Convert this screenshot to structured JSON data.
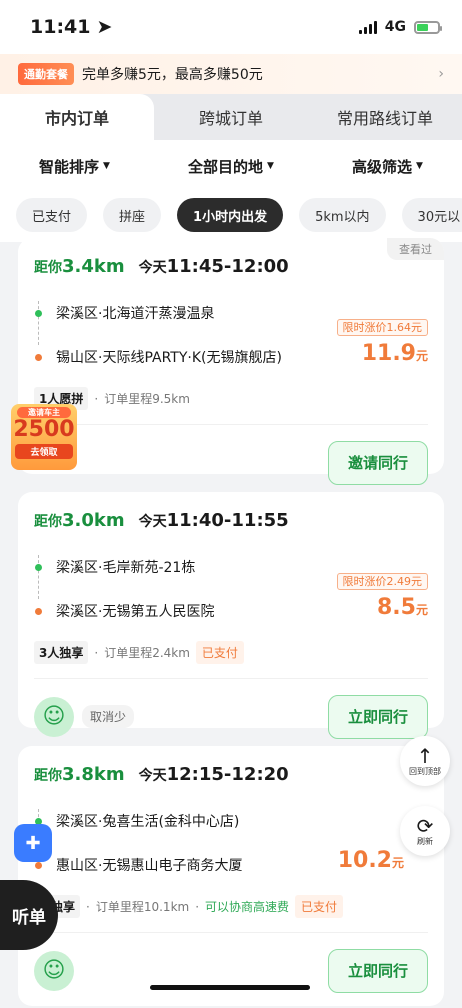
{
  "status": {
    "time": "11:41",
    "network": "4G"
  },
  "promo": {
    "tag": "通勤套餐",
    "text": "完单多赚5元，最高多赚50元",
    "arrow": "›"
  },
  "tabs": [
    "市内订单",
    "跨城订单",
    "常用路线订单"
  ],
  "filters": [
    "智能排序",
    "全部目的地",
    "高级筛选"
  ],
  "chips": [
    "已支付",
    "拼座",
    "1小时内出发",
    "5km以内",
    "30元以"
  ],
  "orders": [
    {
      "viewed": "查看过",
      "dist_prefix": "距你",
      "dist": "3.4km",
      "day": "今天",
      "time": "11:45-12:00",
      "from": "梁溪区·北海道汗蒸漫温泉",
      "to": "锡山区·天际线PARTY·K(无锡旗舰店)",
      "hike": "限时涨价1.64元",
      "price": "11.9",
      "unit": "元",
      "seat": "1人愿拼",
      "mileage": "订单里程9.5km",
      "button": "邀请同行"
    },
    {
      "dist_prefix": "距你",
      "dist": "3.0km",
      "day": "今天",
      "time": "11:40-11:55",
      "from": "梁溪区·毛岸新苑-21栋",
      "to": "梁溪区·无锡第五人民医院",
      "hike": "限时涨价2.49元",
      "price": "8.5",
      "unit": "元",
      "seat": "3人独享",
      "mileage": "订单里程2.4km",
      "paid": "已支付",
      "cancel": "取消少",
      "button": "立即同行"
    },
    {
      "dist_prefix": "距你",
      "dist": "3.8km",
      "day": "今天",
      "time": "12:15-12:20",
      "from": "梁溪区·兔喜生活(金科中心店)",
      "to": "惠山区·无锡惠山电子商务大厦",
      "price": "10.2",
      "unit": "元",
      "seat": "人独享",
      "mileage": "订单里程10.1km",
      "highway": "可以协商高速费",
      "paid": "已支付",
      "button": "立即同行"
    }
  ],
  "invite": {
    "t1": "邀请车主",
    "t2": "2500",
    "t3": "去领取"
  },
  "float": {
    "top": "回到顶部",
    "refresh": "刷新"
  },
  "listen": "听单"
}
